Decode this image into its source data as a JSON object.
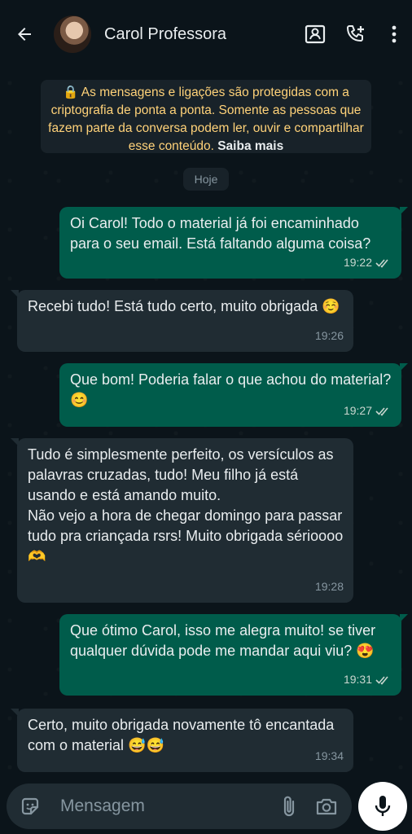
{
  "header": {
    "contact_name": "Carol Professora",
    "icons": [
      "back-arrow-icon",
      "contact-avatar",
      "video-call-icon",
      "add-call-icon",
      "more-options-icon"
    ]
  },
  "notice": {
    "text": "🔒 As mensagens e ligações são protegidas com a criptografia de ponta a ponta. Somente as pessoas que fazem parte da conversa podem ler, ouvir e compartilhar esse conteúdo. ",
    "link": "Saiba mais"
  },
  "date_separator": "Hoje",
  "messages": [
    {
      "direction": "out",
      "text": "Oi Carol! Todo o material já foi encaminhado para o seu email. Está faltando alguma coisa?",
      "time": "19:22",
      "status": "read"
    },
    {
      "direction": "in",
      "text": "Recebi tudo! Está tudo certo, muito obrigada ☺️",
      "time": "19:26"
    },
    {
      "direction": "out",
      "text": "Que bom! Poderia falar o que achou do material? 😊",
      "time": "19:27",
      "status": "read"
    },
    {
      "direction": "in",
      "text": "Tudo é simplesmente perfeito, os versículos as palavras cruzadas, tudo! Meu filho já está usando e está amando muito.\nNão vejo a hora de chegar domingo para passar tudo pra criançada rsrs! Muito obrigada sérioooo 🫶",
      "time": "19:28"
    },
    {
      "direction": "out",
      "text": "Que ótimo Carol, isso me alegra muito! se tiver qualquer dúvida pode me mandar aqui viu? 😍",
      "time": "19:31",
      "status": "read"
    },
    {
      "direction": "in",
      "text": "Certo, muito obrigada novamente tô encantada com o material 😅😅",
      "time": "19:34"
    }
  ],
  "input": {
    "placeholder": "Mensagem",
    "icons": [
      "emoji-sticker-icon",
      "attach-icon",
      "camera-icon",
      "mic-icon"
    ]
  },
  "colors": {
    "background": "#0b141a",
    "outgoing_bubble": "#005c4b",
    "incoming_bubble": "#202c33",
    "notice_text": "#ffd279",
    "read_ticks": "#c9d6cf",
    "mic_button": "#ffffff"
  }
}
